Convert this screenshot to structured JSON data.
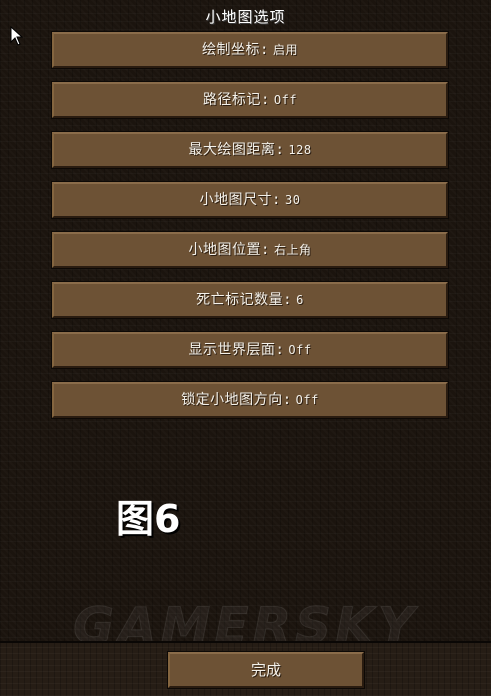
{
  "screen": {
    "title": "小地图选项"
  },
  "options": [
    {
      "label": "绘制坐标",
      "sep": ":",
      "value": "启用"
    },
    {
      "label": "路径标记",
      "sep": ":",
      "value": "Off"
    },
    {
      "label": "最大绘图距离",
      "sep": ":",
      "value": "128"
    },
    {
      "label": "小地图尺寸",
      "sep": ":",
      "value": "30"
    },
    {
      "label": "小地图位置",
      "sep": ":",
      "value": "右上角"
    },
    {
      "label": "死亡标记数量",
      "sep": ":",
      "value": "6"
    },
    {
      "label": "显示世界层面",
      "sep": ":",
      "value": "Off"
    },
    {
      "label": "锁定小地图方向",
      "sep": ":",
      "value": "Off"
    }
  ],
  "done_button": {
    "label": "完成"
  },
  "figure_label": "图6",
  "watermark": "GAMERSKY",
  "colors": {
    "button_face": "#6d5235",
    "button_highlight": "#8a6c4a",
    "button_shadow": "#2a1c10",
    "background": "#1b140e",
    "text": "#f4f1ea"
  },
  "icons": {
    "cursor": "arrow-cursor-icon"
  }
}
